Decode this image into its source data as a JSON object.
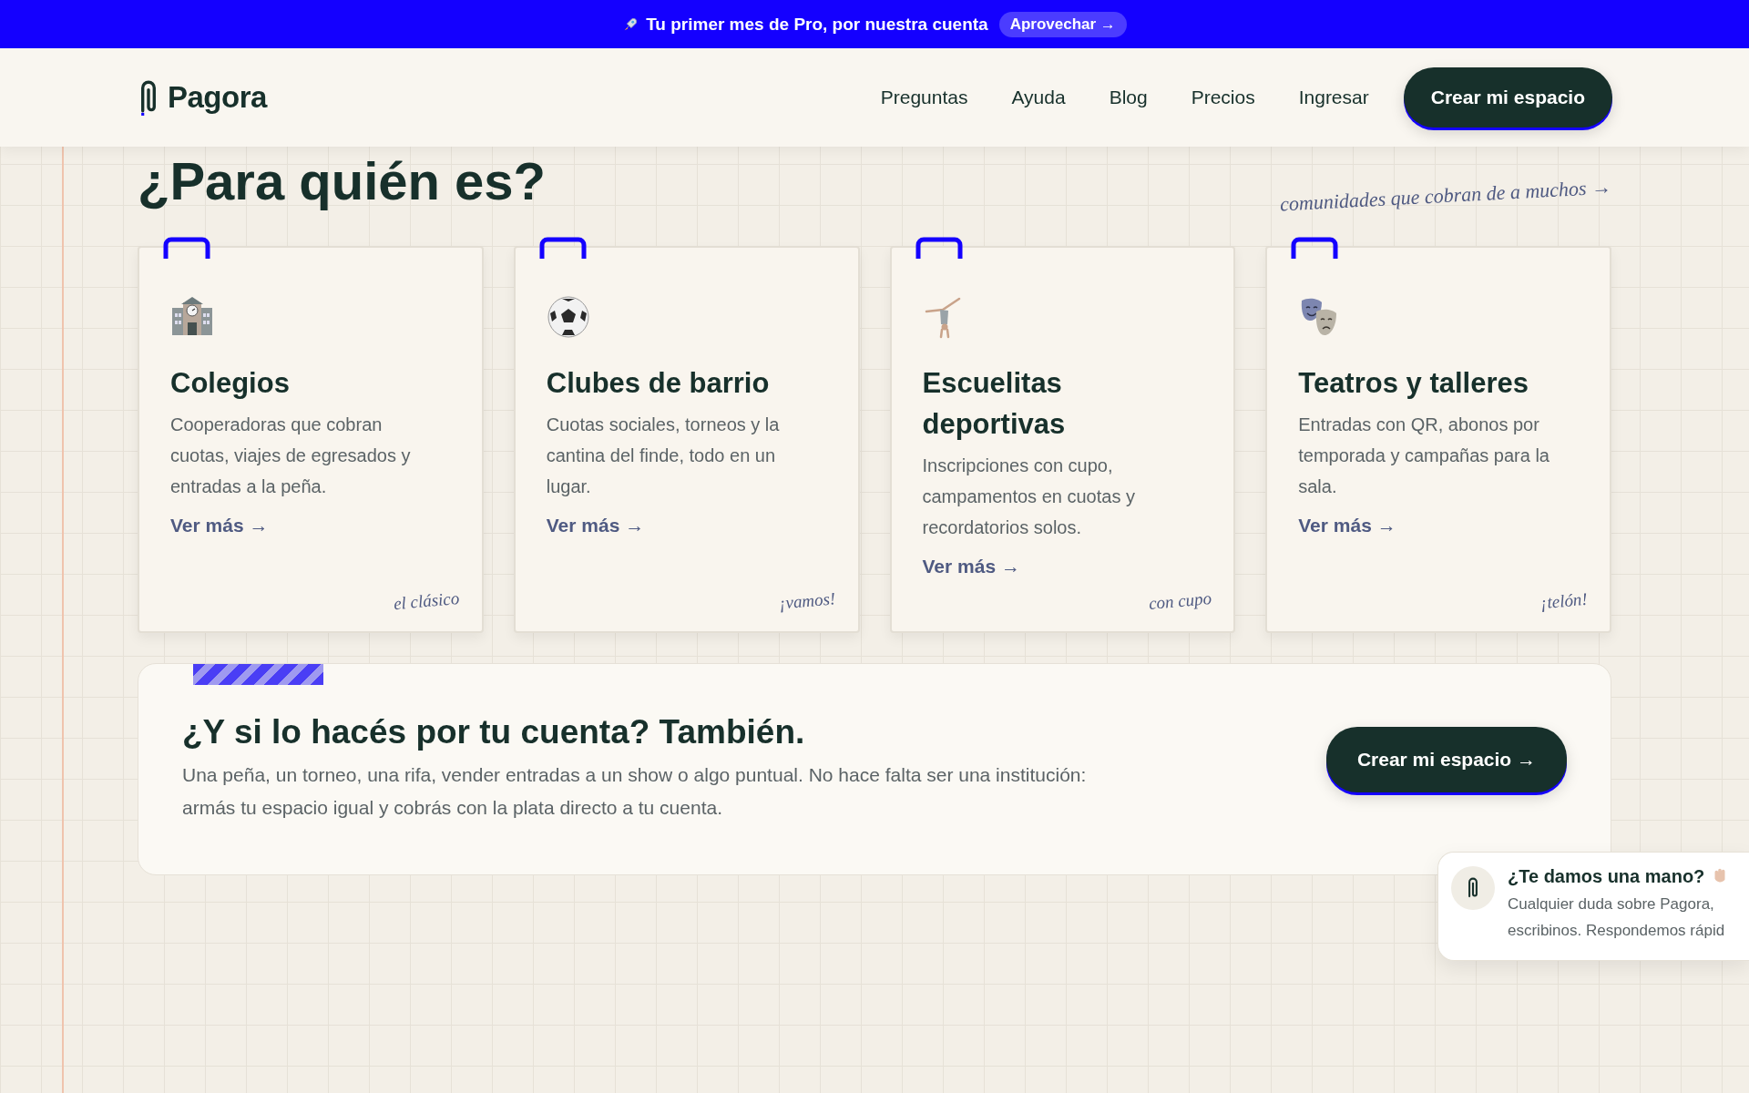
{
  "banner": {
    "text": "Tu primer mes de Pro, por nuestra cuenta",
    "link": "Aprovechar →"
  },
  "nav": {
    "logo": "Pagora",
    "links": [
      "Preguntas",
      "Ayuda",
      "Blog",
      "Precios",
      "Ingresar"
    ],
    "cta": "Crear mi espacio"
  },
  "section": {
    "title": "¿Para quién es?",
    "note": "comunidades que cobran de a muchos →"
  },
  "cards": [
    {
      "kind": "school",
      "title": "Colegios",
      "description": "Cooperadoras que cobran cuotas, viajes de egresados y entradas a la peña.",
      "link": "Ver más →",
      "note": "el clásico"
    },
    {
      "kind": "ball",
      "title": "Clubes de barrio",
      "description": "Cuotas sociales, torneos y la cantina del finde, todo en un lugar.",
      "link": "Ver más →",
      "note": "¡vamos!"
    },
    {
      "kind": "gymnast",
      "title": "Escuelitas deportivas",
      "description": "Inscripciones con cupo, campamentos en cuotas y recordatorios solos.",
      "link": "Ver más →",
      "note": "con cupo"
    },
    {
      "kind": "masks",
      "title": "Teatros y talleres",
      "description": "Entradas con QR, abonos por temporada y campañas para la sala.",
      "link": "Ver más →",
      "note": "¡telón!"
    }
  ],
  "cta": {
    "title": "¿Y si lo hacés por tu cuenta? También.",
    "text": "Una peña, un torneo, una rifa, vender entradas a un show o algo puntual. No hace falta ser una institución: armás tu espacio igual y cobrás con la plata directo a tu cuenta.",
    "button": "Crear mi espacio →"
  },
  "chat": {
    "title": "¿Te damos una mano?",
    "text": "Cualquier duda sobre Pagora, escribinos. Respondemos rápid"
  }
}
